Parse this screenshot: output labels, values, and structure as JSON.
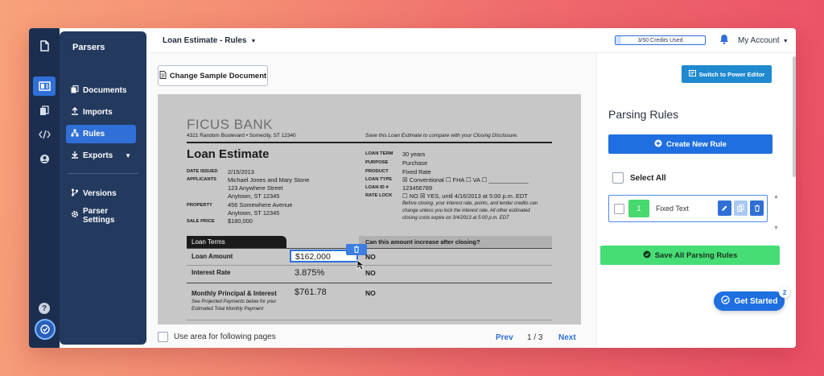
{
  "sidebar": {
    "title": "Parsers",
    "items": [
      {
        "label": "Documents"
      },
      {
        "label": "Imports"
      },
      {
        "label": "Rules"
      },
      {
        "label": "Exports"
      },
      {
        "label": "Versions"
      },
      {
        "label": "Parser Settings"
      }
    ]
  },
  "topbar": {
    "doc_title": "Loan Estimate - Rules",
    "credits": "3/50 Credits Used",
    "credits_used": 3,
    "credits_total": 50,
    "account": "My Account"
  },
  "document": {
    "change_button": "Change Sample Document",
    "use_area_label": "Use area for following pages",
    "prev": "Prev",
    "page_indicator": "1 / 3",
    "next": "Next",
    "sample": {
      "brand": "FICUS BANK",
      "address": "4321 Random Boulevard • Somecity, ST 12340",
      "save_note": "Save this Loan Estimate to compare with your Closing Disclosure.",
      "heading": "Loan Estimate",
      "date_issued_label": "DATE ISSUED",
      "date_issued": "2/15/2013",
      "applicants_label": "APPLICANTS",
      "applicants_1": "Michael Jones and Mary Stone",
      "applicants_2": "123 Anywhere Street",
      "applicants_3": "Anytown, ST 12345",
      "property_label": "PROPERTY",
      "property_1": "456 Somewhere Avenue",
      "property_2": "Anytown, ST 12345",
      "sale_price_label": "SALE PRICE",
      "sale_price": "$180,000",
      "loan_term_label": "LOAN TERM",
      "loan_term": "30 years",
      "purpose_label": "PURPOSE",
      "purpose": "Purchase",
      "product_label": "PRODUCT",
      "product": "Fixed Rate",
      "loan_type_label": "LOAN TYPE",
      "loan_type": "☒ Conventional  ☐ FHA  ☐ VA  ☐ ____________",
      "loan_id_label": "LOAN ID #",
      "loan_id": "123456789",
      "rate_lock_label": "RATE LOCK",
      "rate_lock": "☐ NO  ☒ YES, until 4/16/2013 at 5:00 p.m. EDT",
      "rate_note_1": "Before closing, your interest rate, points, and lender credits can",
      "rate_note_2": "change unless you lock the interest rate. All other estimated",
      "rate_note_3": "closing costs expire on 3/4/2013 at 5:00 p.m. EDT",
      "loan_terms_tab": "Loan Terms",
      "increase_heading": "Can this amount increase after closing?",
      "loan_amount_label": "Loan Amount",
      "loan_amount": "$162,000",
      "loan_amount_answer": "NO",
      "interest_rate_label": "Interest Rate",
      "interest_rate": "3.875%",
      "interest_rate_answer": "NO",
      "monthly_label": "Monthly Principal & Interest",
      "monthly_note_1": "See Projected Payments below for your",
      "monthly_note_2": "Estimated Total Monthly Payment",
      "monthly_value": "$761.78",
      "monthly_answer": "NO"
    }
  },
  "rules_panel": {
    "power_editor": "Switch to Power Editor",
    "title": "Parsing Rules",
    "create_button": "Create New Rule",
    "select_all": "Select All",
    "rule": {
      "number": "1",
      "name": "Fixed Text"
    },
    "save_button": "Save All Parsing Rules",
    "get_started": "Get Started",
    "get_started_badge": "2"
  },
  "help_label": "?",
  "colors": {
    "rail": "#1c2e4f",
    "sidebar": "#233a5e",
    "accent": "#2f6fd6",
    "success": "#47dd75"
  }
}
